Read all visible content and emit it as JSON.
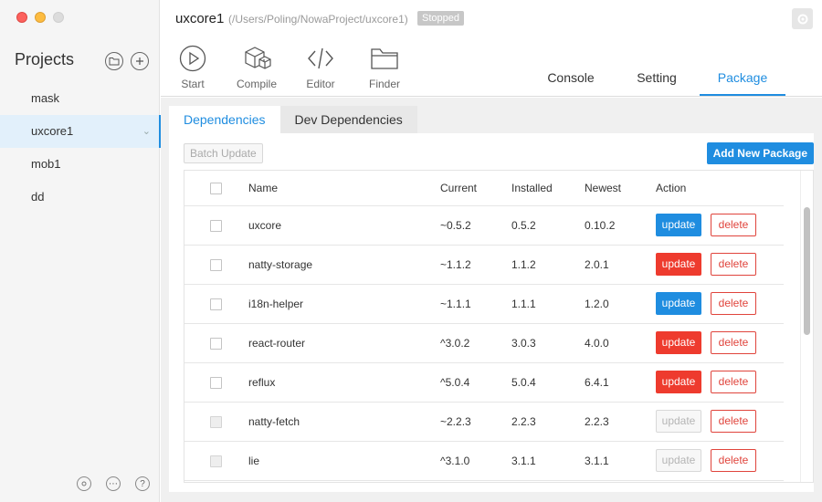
{
  "window": {
    "project_name": "uxcore1",
    "project_path": "(/Users/Poling/NowaProject/uxcore1)",
    "status": "Stopped"
  },
  "sidebar": {
    "title": "Projects",
    "items": [
      {
        "label": "mask"
      },
      {
        "label": "uxcore1"
      },
      {
        "label": "mob1"
      },
      {
        "label": "dd"
      }
    ],
    "footer_icons": [
      "settings-icon",
      "chat-icon",
      "help-icon"
    ]
  },
  "toolbar": {
    "start_label": "Start",
    "compile_label": "Compile",
    "editor_label": "Editor",
    "finder_label": "Finder"
  },
  "tabs": [
    {
      "label": "Console"
    },
    {
      "label": "Setting"
    },
    {
      "label": "Package"
    }
  ],
  "package": {
    "subtabs": [
      {
        "label": "Dependencies"
      },
      {
        "label": "Dev Dependencies"
      }
    ],
    "batch_update_label": "Batch Update",
    "add_package_label": "Add New Package",
    "columns": {
      "name": "Name",
      "current": "Current",
      "installed": "Installed",
      "newest": "Newest",
      "action": "Action"
    },
    "rows": [
      {
        "name": "uxcore",
        "current": "~0.5.2",
        "installed": "0.5.2",
        "newest": "0.10.2",
        "update": "update",
        "delete": "delete"
      },
      {
        "name": "natty-storage",
        "current": "~1.1.2",
        "installed": "1.1.2",
        "newest": "2.0.1",
        "update": "update",
        "delete": "delete"
      },
      {
        "name": "i18n-helper",
        "current": "~1.1.1",
        "installed": "1.1.1",
        "newest": "1.2.0",
        "update": "update",
        "delete": "delete"
      },
      {
        "name": "react-router",
        "current": "^3.0.2",
        "installed": "3.0.3",
        "newest": "4.0.0",
        "update": "update",
        "delete": "delete"
      },
      {
        "name": "reflux",
        "current": "^5.0.4",
        "installed": "5.0.4",
        "newest": "6.4.1",
        "update": "update",
        "delete": "delete"
      },
      {
        "name": "natty-fetch",
        "current": "~2.2.3",
        "installed": "2.2.3",
        "newest": "2.2.3",
        "update": "update",
        "delete": "delete"
      },
      {
        "name": "lie",
        "current": "^3.1.0",
        "installed": "3.1.1",
        "newest": "3.1.1",
        "update": "update",
        "delete": "delete"
      }
    ]
  },
  "colors": {
    "accent": "#1f8de0",
    "danger": "#ee3b2e",
    "muted": "#b5b5b5"
  }
}
